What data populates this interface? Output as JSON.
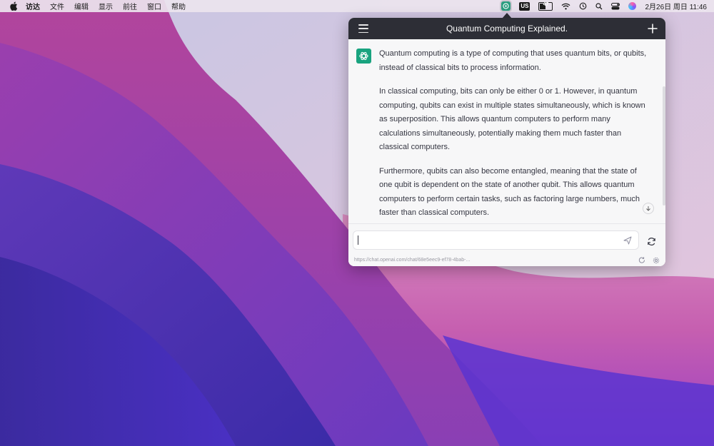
{
  "menubar": {
    "app_name": "访达",
    "menus": [
      "文件",
      "编辑",
      "显示",
      "前往",
      "窗口",
      "帮助"
    ],
    "input_source": "US",
    "battery_level": "47",
    "clock": "2月26日 周日  11:46"
  },
  "chat": {
    "title": "Quantum Computing Explained.",
    "paragraphs": [
      "Quantum computing is a type of computing that uses quantum bits, or qubits, instead of classical bits to process information.",
      "In classical computing, bits can only be either 0 or 1. However, in quantum computing, qubits can exist in multiple states simultaneously, which is known as superposition. This allows quantum computers to perform many calculations simultaneously, potentially making them much faster than classical computers.",
      "Furthermore, qubits can also become entangled, meaning that the state of one qubit is dependent on the state of another qubit. This allows quantum computers to perform certain tasks, such as factoring large numbers, much faster than classical computers."
    ],
    "input_value": "",
    "url_status": "https://chat.openai.com/chat/68e5eec9-ef78-4bab-..."
  },
  "colors": {
    "header_bg": "#2d2e36",
    "avatar_bg": "#19a37f",
    "tray_icon": "#2a9d7f"
  }
}
